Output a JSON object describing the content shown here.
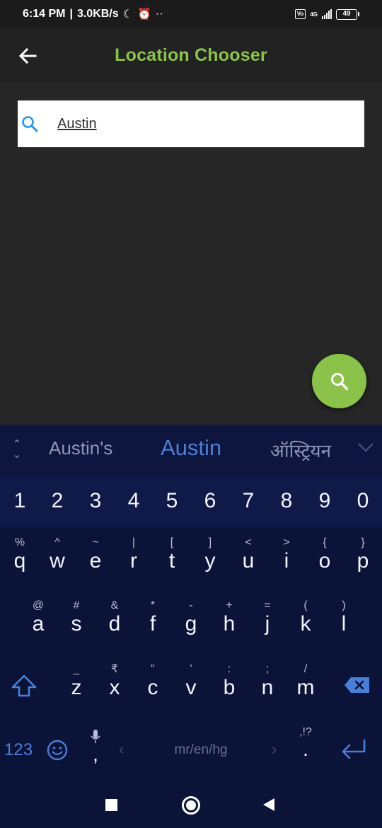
{
  "status_bar": {
    "time": "6:14 PM",
    "speed": "3.0KB/s",
    "network": "4G",
    "volte": "Vo LTE",
    "battery": "49"
  },
  "app_bar": {
    "title": "Location Chooser",
    "accent_color": "#8bc34a"
  },
  "search": {
    "value": "Austin",
    "icon": "search-icon"
  },
  "fab": {
    "icon": "search-icon"
  },
  "keyboard": {
    "suggestions": [
      "Austin's",
      "Austin",
      "ऑस्ट्रियन"
    ],
    "numbers": [
      "1",
      "2",
      "3",
      "4",
      "5",
      "6",
      "7",
      "8",
      "9",
      "0"
    ],
    "row1": [
      {
        "main": "q",
        "sub": "%"
      },
      {
        "main": "w",
        "sub": "^"
      },
      {
        "main": "e",
        "sub": "~"
      },
      {
        "main": "r",
        "sub": "|"
      },
      {
        "main": "t",
        "sub": "["
      },
      {
        "main": "y",
        "sub": "]"
      },
      {
        "main": "u",
        "sub": "<"
      },
      {
        "main": "i",
        "sub": ">"
      },
      {
        "main": "o",
        "sub": "{"
      },
      {
        "main": "p",
        "sub": "}"
      }
    ],
    "row2": [
      {
        "main": "a",
        "sub": "@"
      },
      {
        "main": "s",
        "sub": "#"
      },
      {
        "main": "d",
        "sub": "&"
      },
      {
        "main": "f",
        "sub": "*"
      },
      {
        "main": "g",
        "sub": "-"
      },
      {
        "main": "h",
        "sub": "+"
      },
      {
        "main": "j",
        "sub": "="
      },
      {
        "main": "k",
        "sub": "("
      },
      {
        "main": "l",
        "sub": ")"
      }
    ],
    "row3": [
      {
        "main": "z",
        "sub": "_"
      },
      {
        "main": "x",
        "sub": "₹"
      },
      {
        "main": "c",
        "sub": "\""
      },
      {
        "main": "v",
        "sub": "'"
      },
      {
        "main": "b",
        "sub": ":"
      },
      {
        "main": "n",
        "sub": ";"
      },
      {
        "main": "m",
        "sub": "/"
      }
    ],
    "bottom": {
      "mode_key": "123",
      "comma": ",",
      "space_label": "mr/en/hg",
      "lang_left": "‹",
      "lang_right": "›",
      "punct_sub": ",!?",
      "punct_main": "."
    }
  }
}
